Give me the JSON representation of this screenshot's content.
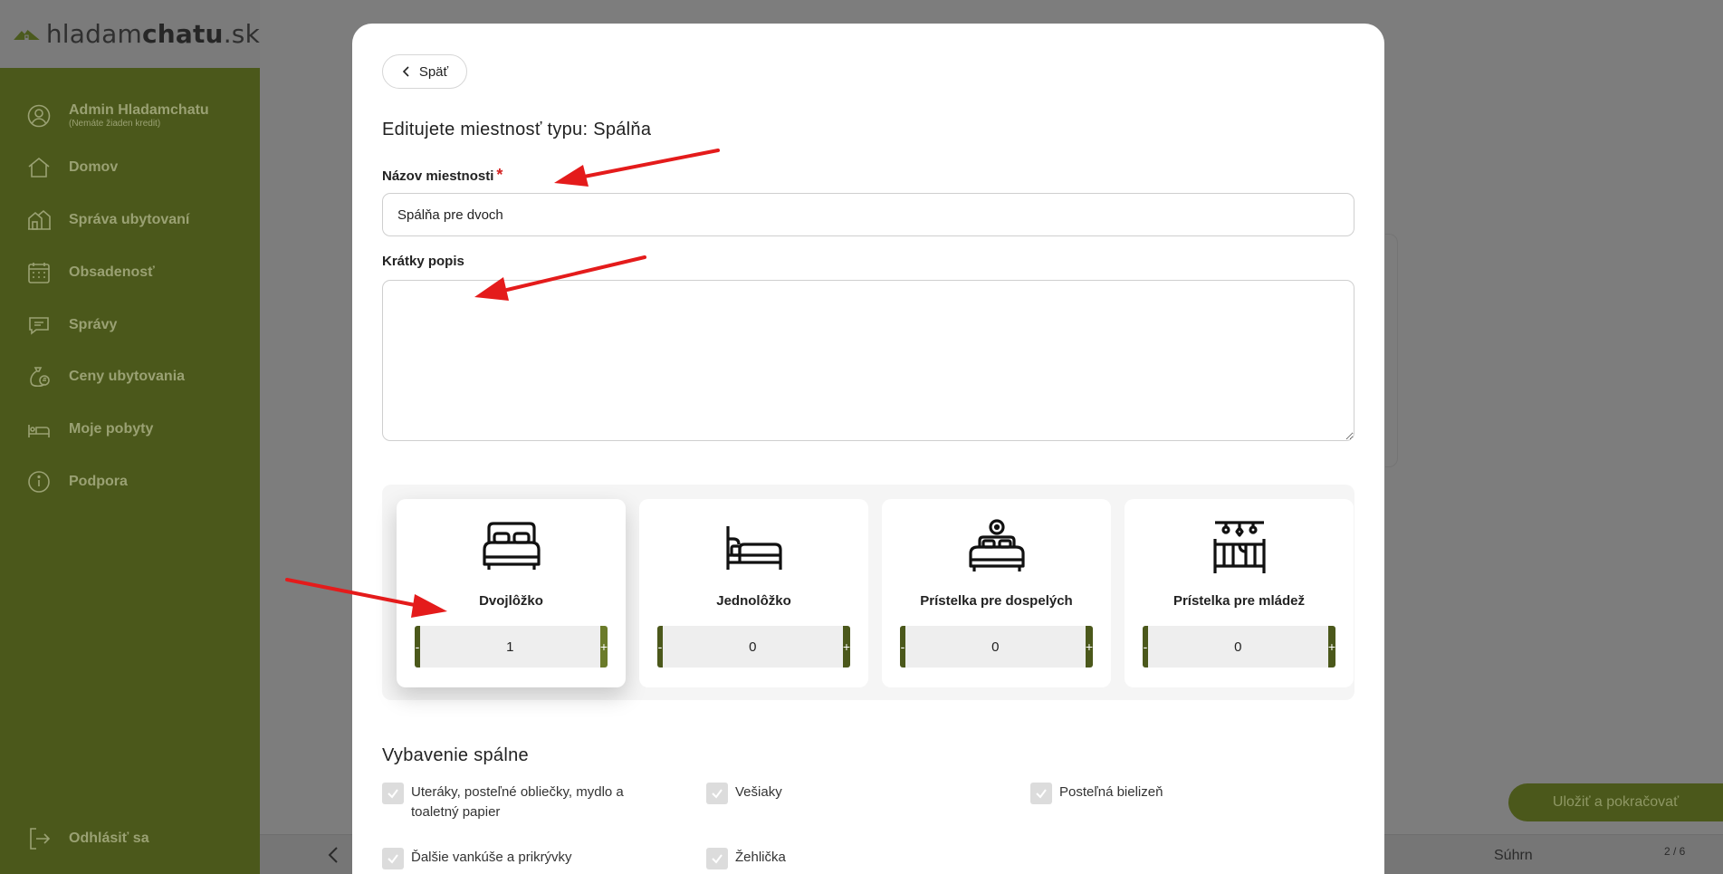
{
  "brand": {
    "logo_light": "hladam",
    "logo_bold": "chatu",
    "logo_tld": ".sk"
  },
  "sidebar": {
    "user": {
      "name": "Admin Hladamchatu",
      "sub": "(Nemáte žiaden kredit)"
    },
    "items": [
      {
        "label": "Domov",
        "icon": "home-icon"
      },
      {
        "label": "Správa ubytovaní",
        "icon": "buildings-icon"
      },
      {
        "label": "Obsadenosť",
        "icon": "calendar-icon"
      },
      {
        "label": "Správy",
        "icon": "message-icon"
      },
      {
        "label": "Ceny ubytovania",
        "icon": "money-bag-icon"
      },
      {
        "label": "Moje pobyty",
        "icon": "bed-icon"
      },
      {
        "label": "Podpora",
        "icon": "info-icon"
      }
    ],
    "logout": "Odhlásiť sa"
  },
  "modal": {
    "back_label": "Späť",
    "title": "Editujete miestnosť typu: Spálňa",
    "name_label": "Názov miestnosti",
    "required_mark": "*",
    "name_value": "Spálňa pre dvoch",
    "desc_label": "Krátky popis",
    "desc_value": "",
    "beds": [
      {
        "name": "Dvojlôžko",
        "value": "1",
        "icon": "double-bed-icon"
      },
      {
        "name": "Jednolôžko",
        "value": "0",
        "icon": "single-bed-icon"
      },
      {
        "name": "Prístelka pre dospelých",
        "value": "0",
        "icon": "adult-extra-bed-icon"
      },
      {
        "name": "Prístelka pre mládež",
        "value": "0",
        "icon": "crib-icon"
      }
    ],
    "minus_label": "-",
    "plus_label": "+",
    "equipment_title": "Vybavenie spálne",
    "equipment": [
      "Uteráky, posteľné obliečky, mydlo a toaletný papier",
      "Vešiaky",
      "Posteľná bielizeň",
      "Ďalšie vankúše a prikrývky",
      "Žehlička"
    ]
  },
  "footer": {
    "save_label": "Uložiť a pokračovať",
    "summary": "Súhrn",
    "steps": "2 / 6"
  },
  "colors": {
    "sidebar_bg": "#4b581b",
    "accent": "#4b581b",
    "accent_light": "#6b7b2a",
    "arrow": "#e41b1b"
  }
}
